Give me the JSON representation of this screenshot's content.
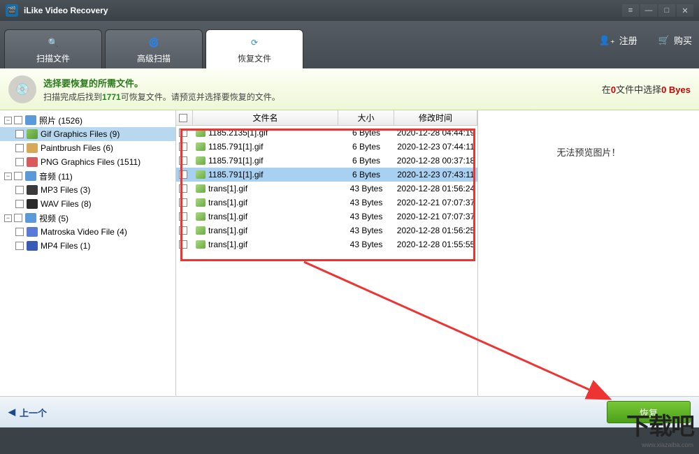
{
  "app": {
    "title": "iLike Video Recovery"
  },
  "toolbar": {
    "tabs": [
      {
        "label": "扫描文件"
      },
      {
        "label": "高级扫描"
      },
      {
        "label": "恢复文件"
      }
    ],
    "register": "注册",
    "buy": "购买"
  },
  "info": {
    "title": "选择要恢复的所需文件。",
    "line2_a": "扫描完成后找到",
    "count": "1771",
    "line2_b": "可恢复文件。请预览并选择要恢复的文件。",
    "right_a": "在",
    "right_red": "0",
    "right_b": "文件中选择",
    "right_c": "0 Byes"
  },
  "tree": {
    "photos": "照片 (1526)",
    "gif": "Gif Graphics Files (9)",
    "pb": "Paintbrush Files (6)",
    "png": "PNG Graphics Files (1511)",
    "audio": "音频 (11)",
    "mp3": "MP3 Files (3)",
    "wav": "WAV Files (8)",
    "video": "视频 (5)",
    "mkv": "Matroska Video File (4)",
    "mp4": "MP4 Files (1)"
  },
  "cols": {
    "name": "文件名",
    "size": "大小",
    "date": "修改时间"
  },
  "files": [
    {
      "name": "1185.2135[1].gif",
      "size": "6 Bytes",
      "date": "2020-12-28 04:44:19"
    },
    {
      "name": "1185.791[1].gif",
      "size": "6 Bytes",
      "date": "2020-12-23 07:44:11"
    },
    {
      "name": "1185.791[1].gif",
      "size": "6 Bytes",
      "date": "2020-12-28 00:37:18"
    },
    {
      "name": "1185.791[1].gif",
      "size": "6 Bytes",
      "date": "2020-12-23 07:43:11"
    },
    {
      "name": "trans[1].gif",
      "size": "43 Bytes",
      "date": "2020-12-28 01:56:24"
    },
    {
      "name": "trans[1].gif",
      "size": "43 Bytes",
      "date": "2020-12-21 07:07:37"
    },
    {
      "name": "trans[1].gif",
      "size": "43 Bytes",
      "date": "2020-12-21 07:07:37"
    },
    {
      "name": "trans[1].gif",
      "size": "43 Bytes",
      "date": "2020-12-28 01:56:25"
    },
    {
      "name": "trans[1].gif",
      "size": "43 Bytes",
      "date": "2020-12-28 01:55:55"
    }
  ],
  "preview": {
    "msg": "无法预览图片！"
  },
  "bottom": {
    "prev": "上一个",
    "recover": "恢复"
  },
  "watermark": {
    "main": "下载吧",
    "sub": "www.xiazaiba.com"
  }
}
